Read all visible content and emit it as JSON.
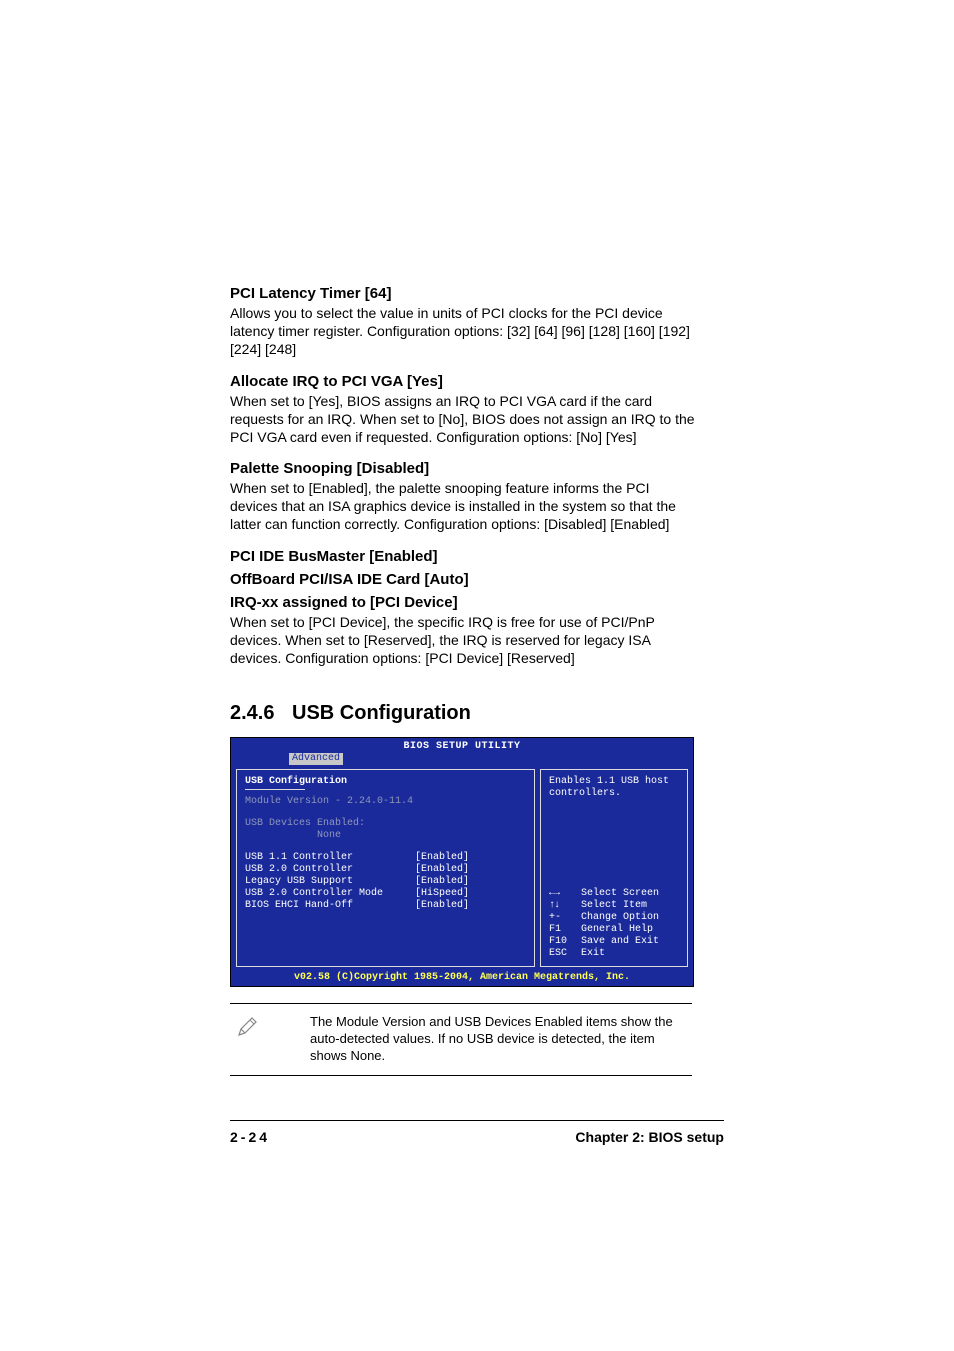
{
  "s1": {
    "title": "PCI Latency Timer [64]",
    "text": "Allows you to select the value in units of PCI clocks for the PCI device latency timer register. Configuration options: [32] [64] [96] [128] [160] [192] [224] [248]"
  },
  "s2": {
    "title": "Allocate IRQ to PCI VGA [Yes]",
    "text": "When set to [Yes], BIOS assigns an IRQ to PCI VGA card if the card requests for an IRQ. When set to [No], BIOS does not assign an IRQ to the PCI VGA card even if requested. Configuration options: [No] [Yes]"
  },
  "s3": {
    "title": "Palette Snooping [Disabled]",
    "text": "When set to [Enabled], the palette snooping feature informs the PCI devices that an ISA graphics device is installed in the system so that the latter can function correctly. Configuration options: [Disabled] [Enabled]"
  },
  "s4": {
    "title": "PCI IDE BusMaster   [Enabled]"
  },
  "s5": {
    "title": "OffBoard PCI/ISA IDE Card  [Auto]"
  },
  "s6": {
    "title": "IRQ-xx assigned to [PCI Device]",
    "text": "When set to [PCI Device], the specific IRQ is free for use of PCI/PnP devices. When set to [Reserved], the IRQ is reserved for legacy ISA devices. Configuration options: [PCI Device] [Reserved]"
  },
  "section": {
    "num": "2.4.6",
    "title": "USB Configuration"
  },
  "bios": {
    "headerTitle": "BIOS SETUP UTILITY",
    "tab": "Advanced",
    "panelTitle": "USB Configuration",
    "moduleLine": "Module Version - 2.24.0-11.4",
    "devLabel": "USB Devices Enabled:",
    "devValue": "None",
    "options": [
      {
        "label": "USB 1.1 Controller",
        "value": "[Enabled]"
      },
      {
        "label": "USB 2.0 Controller",
        "value": "[Enabled]"
      },
      {
        "label": "Legacy USB Support",
        "value": "[Enabled]"
      },
      {
        "label": "USB 2.0 Controller Mode",
        "value": "[HiSpeed]"
      },
      {
        "label": "BIOS EHCI Hand-Off",
        "value": "[Enabled]"
      }
    ],
    "helpText": "Enables 1.1 USB host controllers.",
    "nav": [
      {
        "key": "←→",
        "label": "Select Screen"
      },
      {
        "key": "↑↓",
        "label": "Select Item"
      },
      {
        "key": "+-",
        "label": "Change Option"
      },
      {
        "key": "F1",
        "label": "General Help"
      },
      {
        "key": "F10",
        "label": "Save and Exit"
      },
      {
        "key": "ESC",
        "label": "Exit"
      }
    ],
    "footer": "v02.58 (C)Copyright 1985-2004, American Megatrends, Inc."
  },
  "note": "The Module Version and USB Devices Enabled items show the auto-detected values. If no USB device is detected, the item shows None.",
  "footer": {
    "page": "2-24",
    "chapter": "Chapter 2: BIOS setup"
  }
}
